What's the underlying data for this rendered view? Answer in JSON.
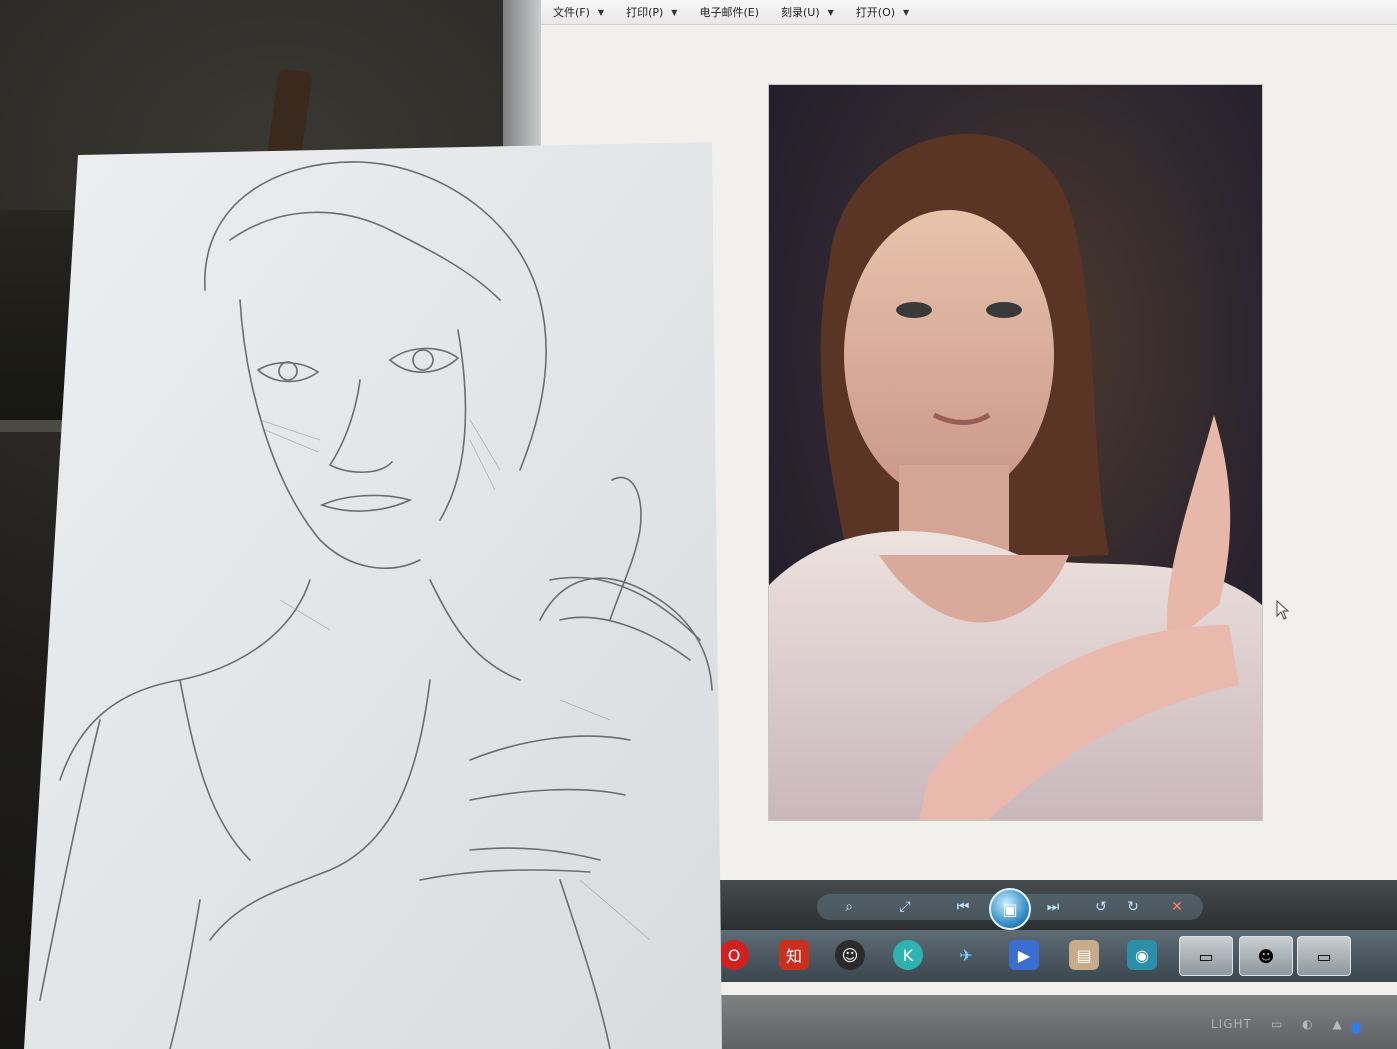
{
  "menubar": {
    "items": [
      {
        "label": "文件(F)"
      },
      {
        "label": "打印(P)"
      },
      {
        "label": "电子邮件(E)"
      },
      {
        "label": "刻录(U)"
      },
      {
        "label": "打开(O)"
      }
    ]
  },
  "viewer": {
    "toolbar_icons": [
      "zoom-icon",
      "fit-window-icon",
      "previous-icon",
      "slideshow-icon",
      "next-icon",
      "rotate-left-icon",
      "rotate-right-icon",
      "delete-icon"
    ]
  },
  "taskbar": {
    "icons": [
      "opera-icon",
      "app-red-icon",
      "qq-icon",
      "k-app-icon",
      "bird-app-icon",
      "media-app-icon",
      "notes-app-icon",
      "camera-app-icon"
    ],
    "tiles": [
      "window-thumbnail-1",
      "window-thumbnail-2",
      "window-thumbnail-3"
    ]
  },
  "monitor": {
    "bezel_label": "LIGHT"
  }
}
